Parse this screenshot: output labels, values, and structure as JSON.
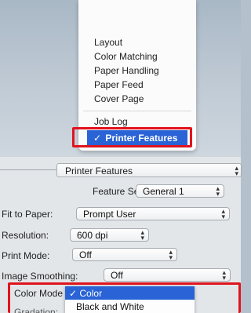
{
  "menu": {
    "items": [
      "Layout",
      "Color Matching",
      "Paper Handling",
      "Paper Feed",
      "Cover Page",
      "Job Log"
    ],
    "selected_check": "✓",
    "selected": "Printer Features"
  },
  "panel": {
    "title_popup": "Printer Features",
    "feature_sets_label": "Feature Sets:",
    "feature_sets_value": "General 1",
    "fit_to_paper_label": "Fit to Paper:",
    "fit_to_paper_value": "Prompt User",
    "resolution_label": "Resolution:",
    "resolution_value": "600 dpi",
    "print_mode_label": "Print Mode:",
    "print_mode_value": "Off",
    "image_smoothing_label": "Image Smoothing:",
    "image_smoothing_value": "Off",
    "color_mode_label": "Color Mode",
    "color_mode_options": [
      "✓ Color",
      "Black and White"
    ],
    "gradation_label": "Gradation:"
  },
  "colors": {
    "highlight": "#2a63d6",
    "callout": "#e0141e"
  }
}
